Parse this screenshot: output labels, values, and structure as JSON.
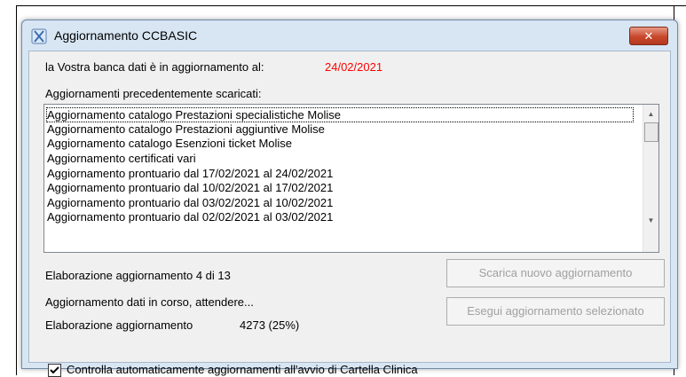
{
  "window": {
    "title": "Aggiornamento CCBASIC",
    "close_label": "✕",
    "icon": "app-x-icon"
  },
  "status": {
    "db_label": "la Vostra banca dati è in aggiornamento al:",
    "db_date": "24/02/2021",
    "date_color": "#ff0000"
  },
  "history": {
    "label": "Aggiornamenti precedentemente scaricati:",
    "items": [
      "Aggiornamento catalogo Prestazioni specialistiche Molise",
      "Aggiornamento catalogo Prestazioni aggiuntive Molise",
      "Aggiornamento catalogo Esenzioni ticket Molise",
      "Aggiornamento certificati vari",
      "Aggiornamento prontuario dal 17/02/2021 al 24/02/2021",
      "Aggiornamento prontuario dal 10/02/2021 al 17/02/2021",
      "Aggiornamento prontuario dal 03/02/2021 al 10/02/2021",
      "Aggiornamento prontuario dal 02/02/2021 al 03/02/2021"
    ]
  },
  "progress": {
    "step_text": "Elaborazione aggiornamento 4 di 13",
    "wait_text": "Aggiornamento dati in corso, attendere...",
    "elab_label": "Elaborazione aggiornamento",
    "elab_value": "4273 (25%)"
  },
  "buttons": {
    "download": "Scarica nuovo aggiornamento",
    "execute": "Esegui aggiornamento selezionato"
  },
  "options": {
    "auto_check_label": "Controlla automaticamente aggiornamenti all'avvio di Cartella Clinica",
    "auto_check_checked": true
  }
}
